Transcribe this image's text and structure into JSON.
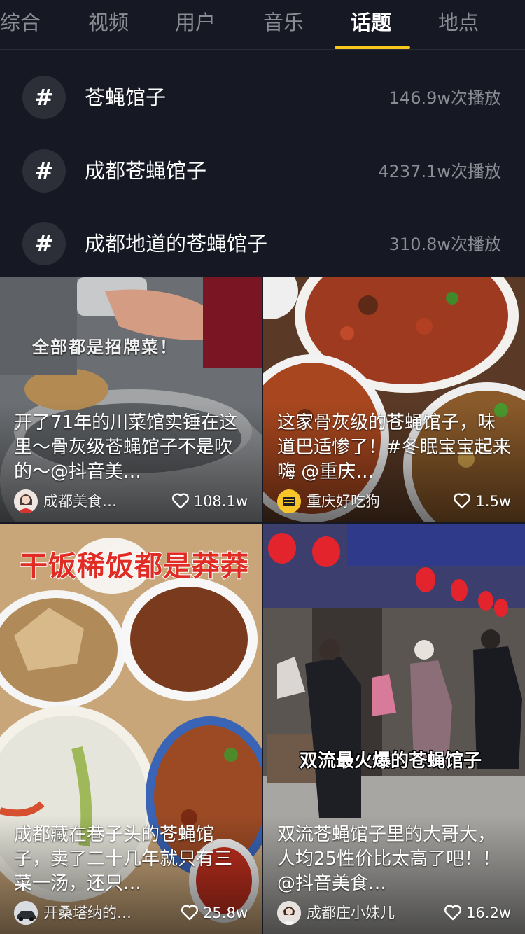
{
  "tabs": [
    {
      "label": "综合"
    },
    {
      "label": "视频"
    },
    {
      "label": "用户"
    },
    {
      "label": "音乐"
    },
    {
      "label": "话题",
      "active": true
    },
    {
      "label": "地点"
    }
  ],
  "topics": [
    {
      "name": "苍蝇馆子",
      "plays": "146.9w次播放"
    },
    {
      "name": "成都苍蝇馆子",
      "plays": "4237.1w次播放"
    },
    {
      "name": "成都地道的苍蝇馆子",
      "plays": "310.8w次播放"
    }
  ],
  "topic_icon": "#",
  "videos": [
    {
      "overlay": "全部都是招牌菜！",
      "description": "开了71年的川菜馆实锤在这里～骨灰级苍蝇馆子不是吹的～@抖音美…",
      "author": "成都美食…",
      "likes": "108.1w"
    },
    {
      "description": "这家骨灰级的苍蝇馆子，味道巴适惨了！#冬眠宝宝起来嗨 @重庆…",
      "author": "重庆好吃狗",
      "likes": "1.5w",
      "avatar_text": "重庆好吃狗"
    },
    {
      "overlay": "干饭稀饭都是莽莽",
      "description": "成都藏在巷子头的苍蝇馆子，卖了二十几年就只有三菜一汤，还只…",
      "author": "开桑塔纳的…",
      "likes": "25.8w"
    },
    {
      "overlay": "双流最火爆的苍蝇馆子",
      "description": "双流苍蝇馆子里的大哥大，人均25性价比太高了吧！！@抖音美食…",
      "author": "成都庄小妹儿",
      "likes": "16.2w"
    }
  ],
  "colors": {
    "background": "#161823",
    "accent": "#f8c81d",
    "muted_text": "#8b8c93"
  },
  "icons": {
    "topic": "hashtag-icon",
    "likes": "heart-outline-icon"
  }
}
